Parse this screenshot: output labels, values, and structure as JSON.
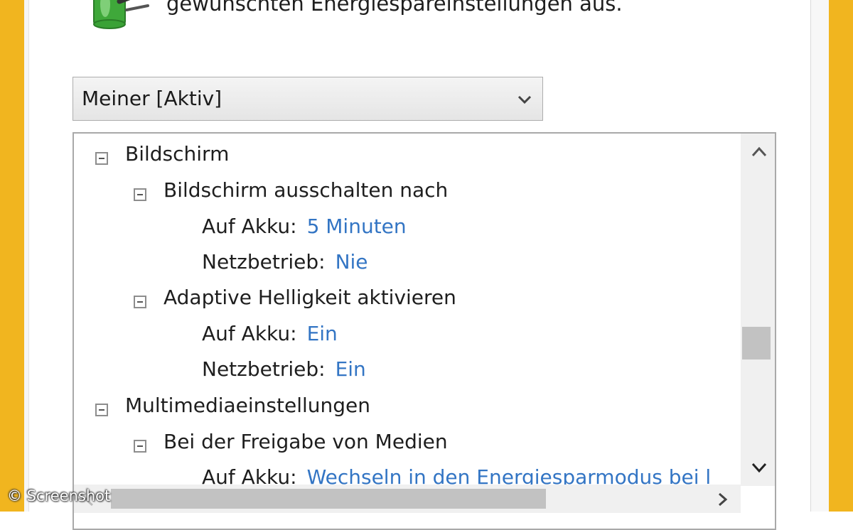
{
  "header": {
    "text": "gewünschten Energiespareinstellungen aus."
  },
  "plan_select": {
    "value": "Meiner [Aktiv]"
  },
  "tree": {
    "group_display": {
      "label": "Bildschirm",
      "turn_off": {
        "label": "Bildschirm ausschalten nach",
        "battery_label": "Auf Akku:",
        "battery_value": "5 Minuten",
        "ac_label": "Netzbetrieb:",
        "ac_value": "Nie"
      },
      "adaptive": {
        "label": "Adaptive Helligkeit aktivieren",
        "battery_label": "Auf Akku:",
        "battery_value": "Ein",
        "ac_label": "Netzbetrieb:",
        "ac_value": "Ein"
      }
    },
    "group_multimedia": {
      "label": "Multimediaeinstellungen",
      "sharing": {
        "label": "Bei der Freigabe von Medien",
        "battery_label": "Auf Akku:",
        "battery_value": "Wechseln in den Energiesparmodus bei l"
      }
    }
  },
  "watermark": "© Screenshot",
  "colors": {
    "frame": "#f1b51f",
    "link": "#3375c4"
  },
  "icons": {
    "header": "battery-plug-icon",
    "dropdown": "chevron-down-icon",
    "tree_toggle": "collapse-icon",
    "scroll_up": "chevron-up-icon",
    "scroll_down": "chevron-down-icon",
    "scroll_right": "chevron-right-icon"
  }
}
